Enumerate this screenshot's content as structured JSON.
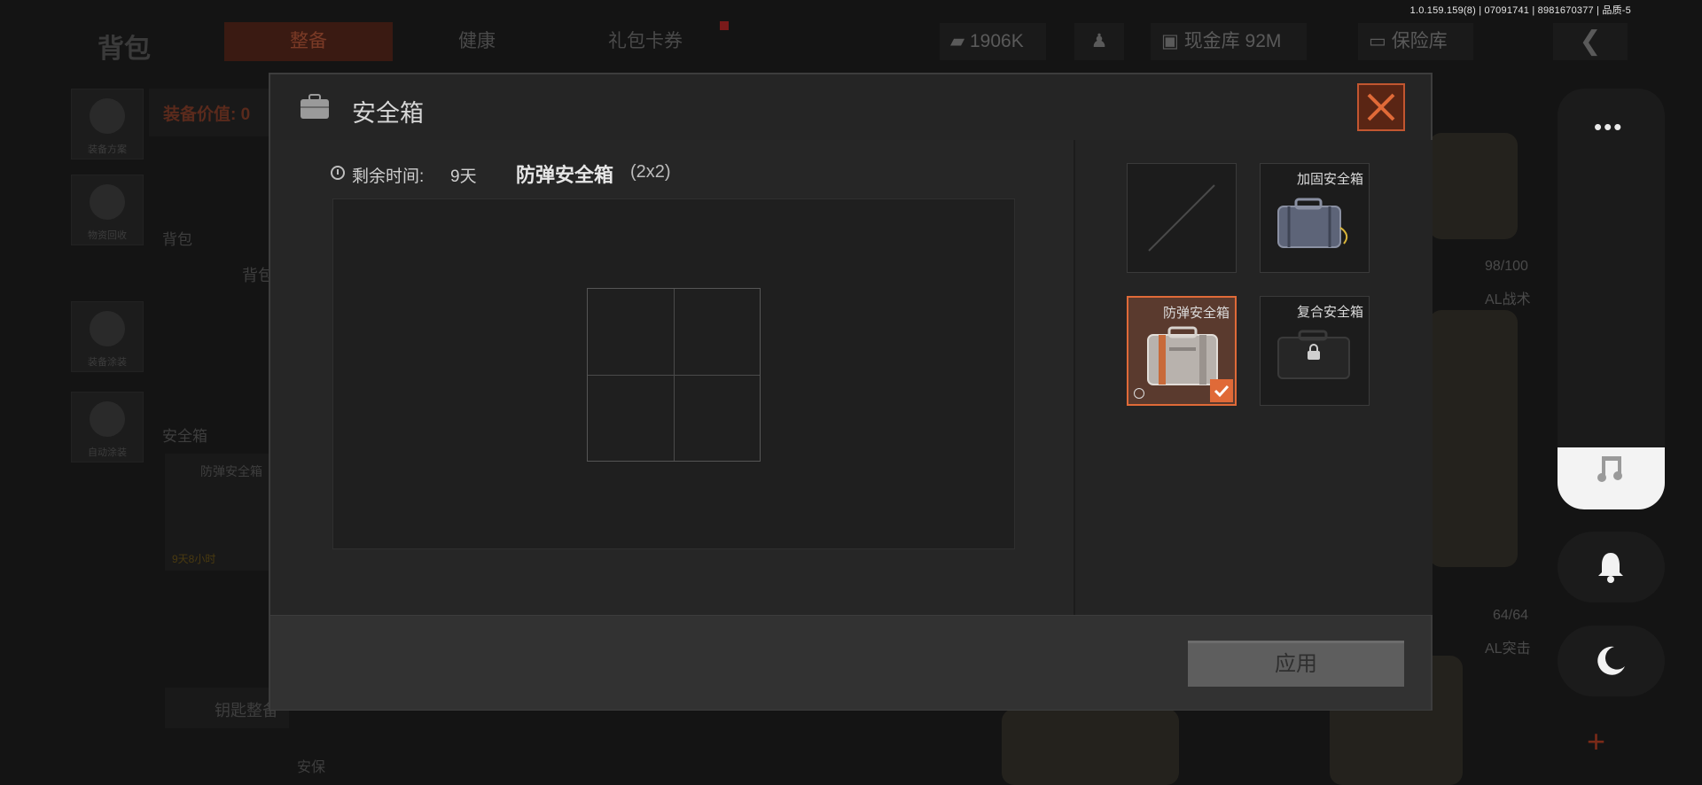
{
  "version_text": "1.0.159.159(8) | 07091741 | 8981670377 | 品质-5",
  "background": {
    "title": "背包",
    "tabs": [
      {
        "label": "整备",
        "active": true
      },
      {
        "label": "健康",
        "active": false
      },
      {
        "label": "礼包卡券",
        "active": false
      }
    ],
    "stats": {
      "currency": "1906K",
      "cash_vault": "现金库 92M",
      "safe_vault": "保险库"
    },
    "sidebar": [
      {
        "label": "装备方案"
      },
      {
        "label": "物资回收"
      },
      {
        "label": "装备涂装"
      },
      {
        "label": "自动涂装"
      }
    ],
    "equip_value_label": "装备价值: 0",
    "backpack_label": "背包",
    "backpack_sub": "背包",
    "safebox_label": "安全箱",
    "safebox_item": "防弹安全箱",
    "safebox_time": "9天8小时",
    "key_label": "钥匙整备",
    "bottom_left": "安保",
    "right_stats": [
      {
        "value": "98/100",
        "name": "AL战术"
      },
      {
        "value": "64/64",
        "name": "AL突击"
      }
    ]
  },
  "modal": {
    "title": "安全箱",
    "time_label": "剩余时间:",
    "time_value": "9天",
    "case_name": "防弹安全箱",
    "case_size": "(2x2)",
    "slots": [
      {
        "name": "",
        "state": "empty"
      },
      {
        "name": "加固安全箱",
        "state": "normal"
      },
      {
        "name": "防弹安全箱",
        "state": "selected"
      },
      {
        "name": "复合安全箱",
        "state": "locked"
      }
    ],
    "apply_label": "应用"
  },
  "float_panel": {
    "more_label": "•••"
  },
  "colors": {
    "accent": "#e06a38",
    "close_border": "#c25630"
  }
}
